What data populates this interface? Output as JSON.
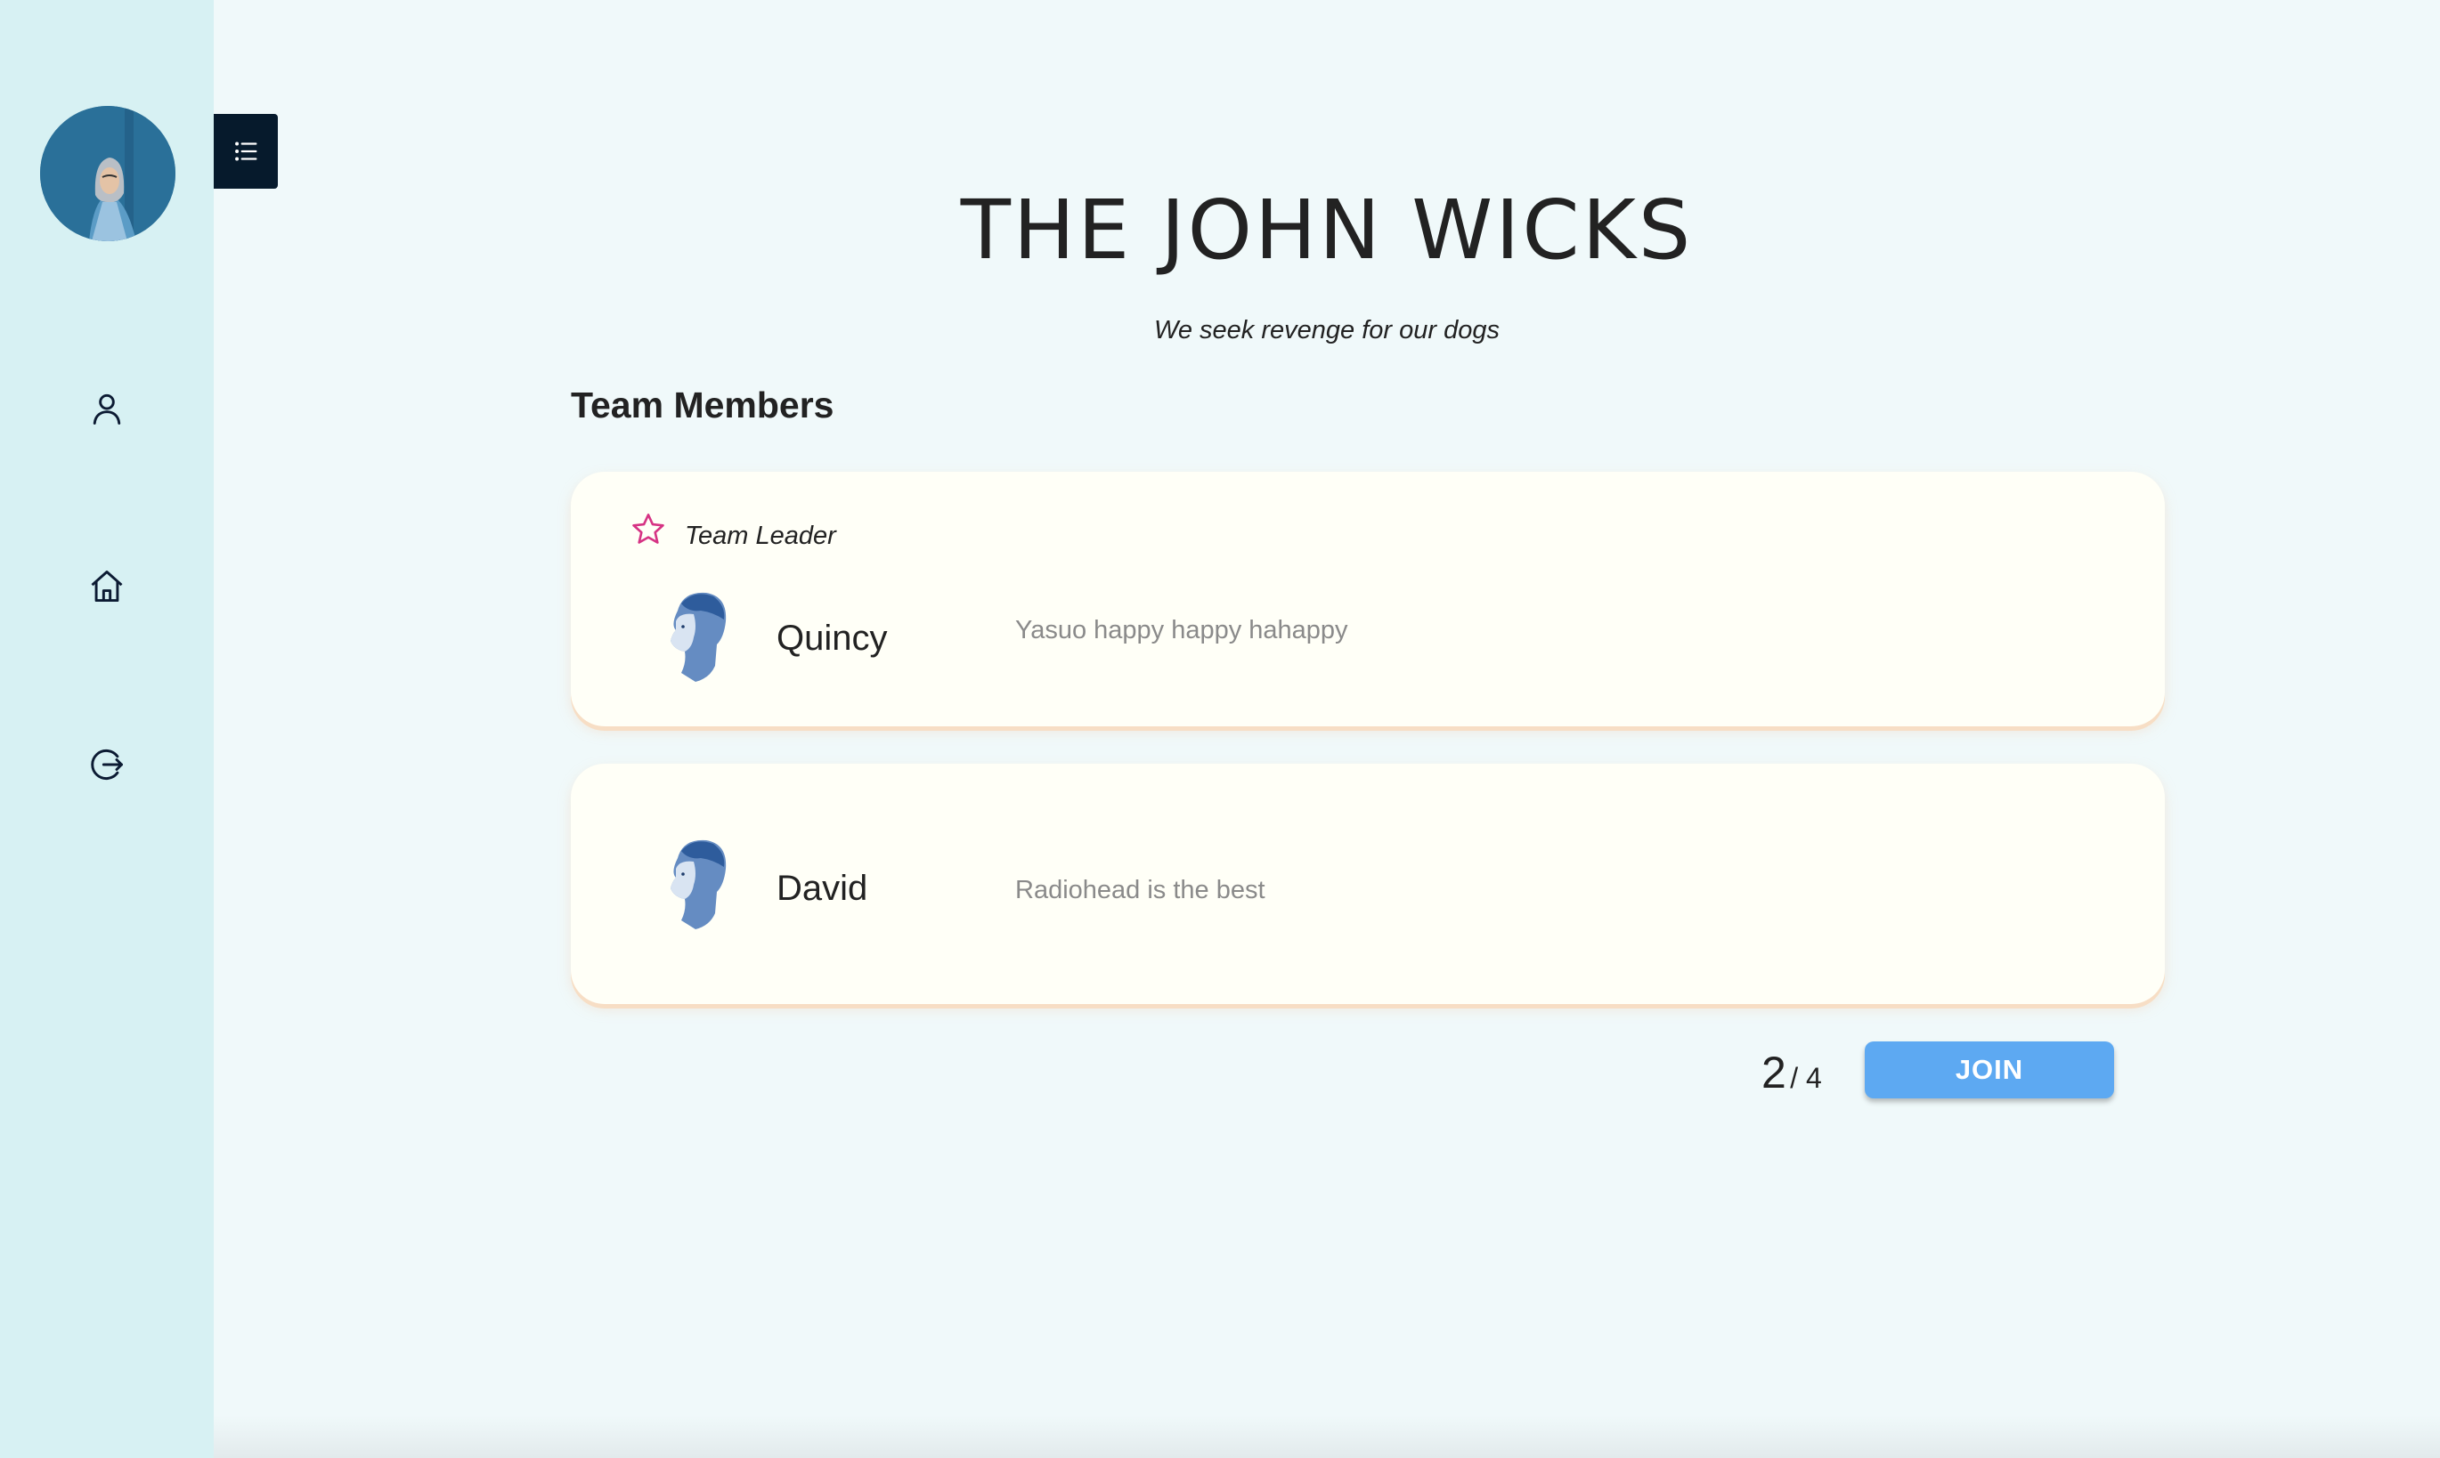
{
  "sidebar": {
    "avatar_icon": "user-photo-avatar",
    "items": [
      {
        "icon": "user-icon"
      },
      {
        "icon": "home-icon"
      },
      {
        "icon": "logout-icon"
      }
    ],
    "toggle_icon": "list-icon"
  },
  "team": {
    "name": "THE JOHN WICKS",
    "tagline": "We seek revenge for our dogs",
    "members_heading": "Team Members",
    "leader_label": "Team Leader",
    "members": [
      {
        "name": "Quincy",
        "description": "Yasuo happy happy hahappy",
        "is_leader": true
      },
      {
        "name": "David",
        "description": "Radiohead is the best",
        "is_leader": false
      }
    ],
    "member_count": "2",
    "member_capacity": "/ 4",
    "join_label": "JOIN"
  },
  "colors": {
    "sidebar_bg": "#d7f1f3",
    "page_bg": "#f0f9fa",
    "card_bg": "#fffff7",
    "accent_star": "#d63384",
    "join_button": "#5da9f2",
    "toggle_bg": "#061a2c"
  }
}
